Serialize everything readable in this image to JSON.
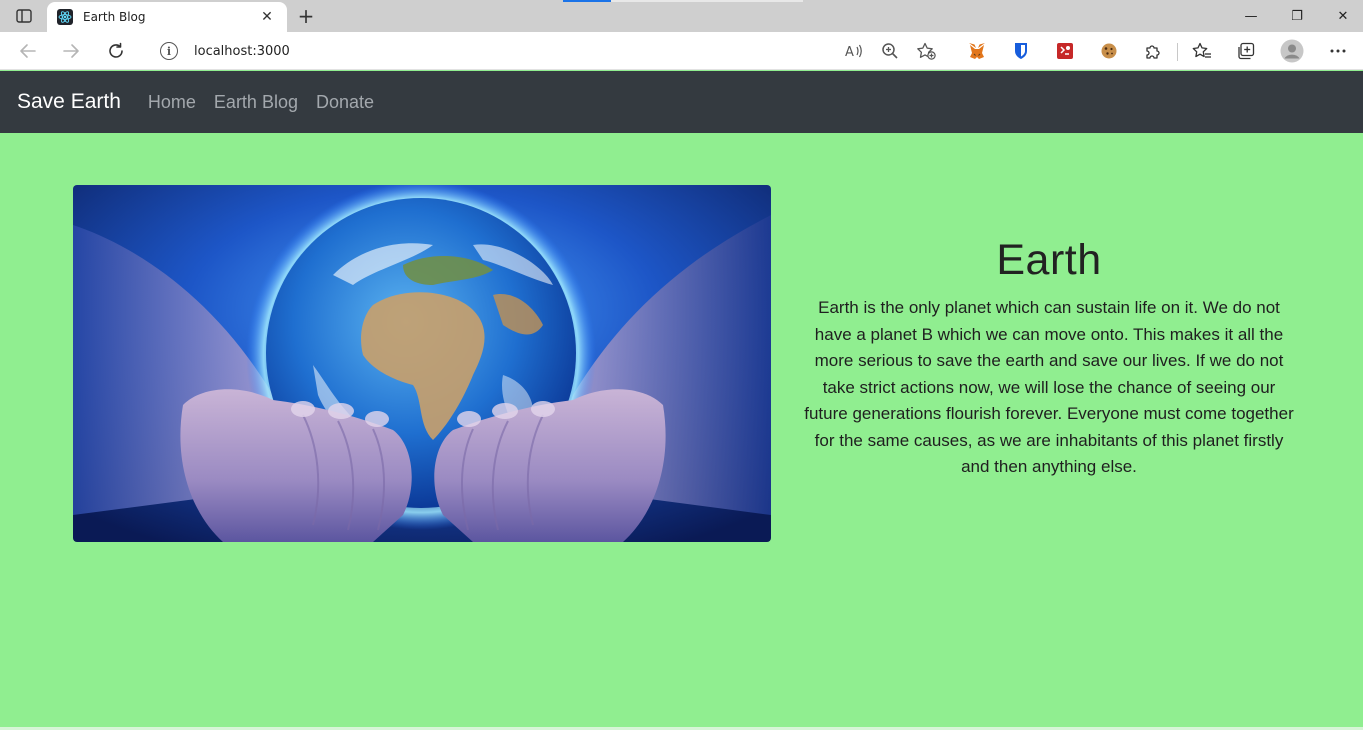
{
  "browser": {
    "tab_title": "Earth Blog",
    "tab_close_glyph": "✕",
    "new_tab_glyph": "+",
    "address": "localhost:3000",
    "address_info_glyph": "i",
    "window_controls": {
      "minimize": "—",
      "restore": "❐",
      "close": "✕"
    },
    "icons": [
      "tab-actions-icon",
      "react-favicon-icon",
      "back-icon",
      "forward-icon",
      "refresh-icon",
      "info-icon",
      "read-aloud-icon",
      "zoom-icon",
      "add-favorite-icon",
      "metamask-extension-icon",
      "bitwarden-extension-icon",
      "red-extension-icon",
      "cookie-extension-icon",
      "extensions-puzzle-icon",
      "favorites-icon",
      "collections-icon",
      "profile-avatar-icon",
      "more-menu-icon"
    ],
    "accent_color": "#1a73e8"
  },
  "site": {
    "brand": "Save Earth",
    "nav": [
      {
        "label": "Home"
      },
      {
        "label": "Earth Blog"
      },
      {
        "label": "Donate"
      }
    ],
    "hero_image_alt": "Earth held in hands",
    "heading": "Earth",
    "body": "Earth is the only planet which can sustain life on it. We do not have a planet B which we can move onto. This makes it all the more serious to save the earth and save our lives. If we do not take strict actions now, we will lose the chance of seeing our future generations flourish forever. Everyone must come together for the same causes, as we are inhabitants of this planet firstly and then anything else.",
    "colors": {
      "page_background": "#90ee90",
      "navbar_background": "#343a40",
      "brand_text": "#ffffff",
      "nav_link_text": "#a3a8ad"
    }
  }
}
